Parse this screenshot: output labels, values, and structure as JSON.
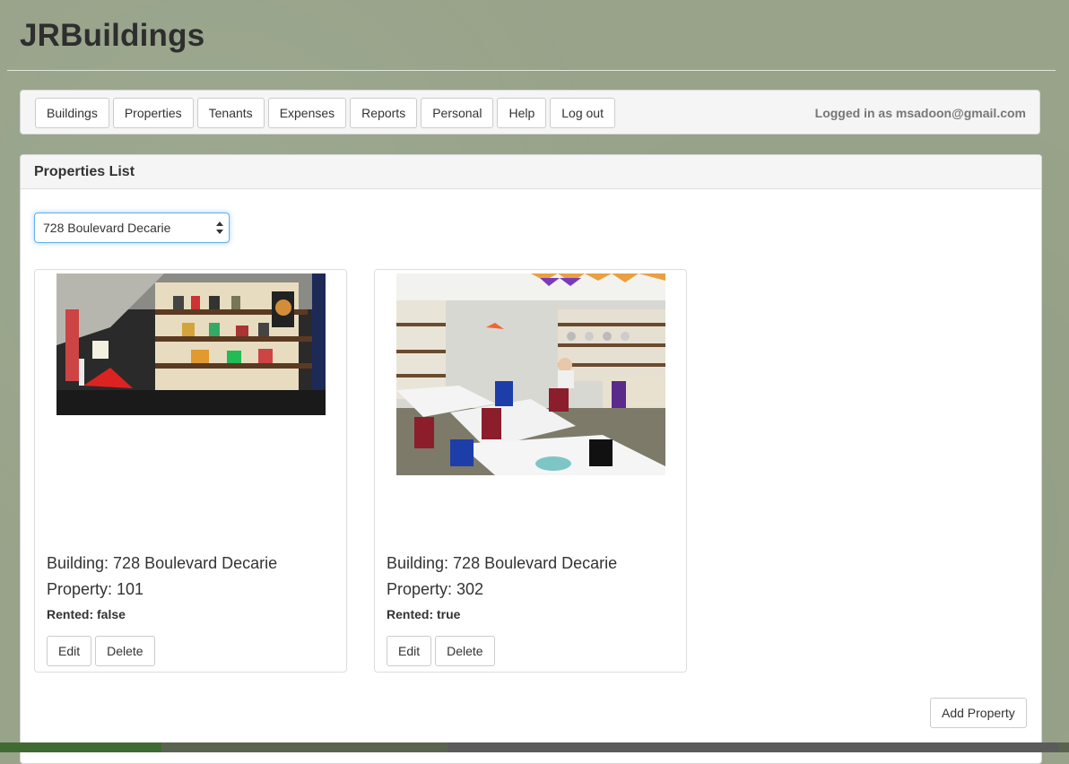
{
  "app": {
    "title": "JRBuildings"
  },
  "nav": {
    "items": [
      {
        "label": "Buildings"
      },
      {
        "label": "Properties"
      },
      {
        "label": "Tenants"
      },
      {
        "label": "Expenses"
      },
      {
        "label": "Reports"
      },
      {
        "label": "Personal"
      },
      {
        "label": "Help"
      },
      {
        "label": "Log out"
      }
    ],
    "logged_in_text": "Logged in as msadoon@gmail.com"
  },
  "panel": {
    "heading": "Properties List",
    "building_select": {
      "selected": "728 Boulevard Decarie"
    },
    "cards": [
      {
        "building": "Building: 728 Boulevard Decarie",
        "property": "Property: 101",
        "rented": "Rented: false",
        "edit_label": "Edit",
        "delete_label": "Delete",
        "photo_icon": "shop-interior-photo"
      },
      {
        "building": "Building: 728 Boulevard Decarie",
        "property": "Property: 302",
        "rented": "Rented: true",
        "edit_label": "Edit",
        "delete_label": "Delete",
        "photo_icon": "pottery-studio-photo"
      }
    ],
    "add_label": "Add Property"
  },
  "colors": {
    "page_background": "#98a38a",
    "select_focus": "#66afe9"
  }
}
